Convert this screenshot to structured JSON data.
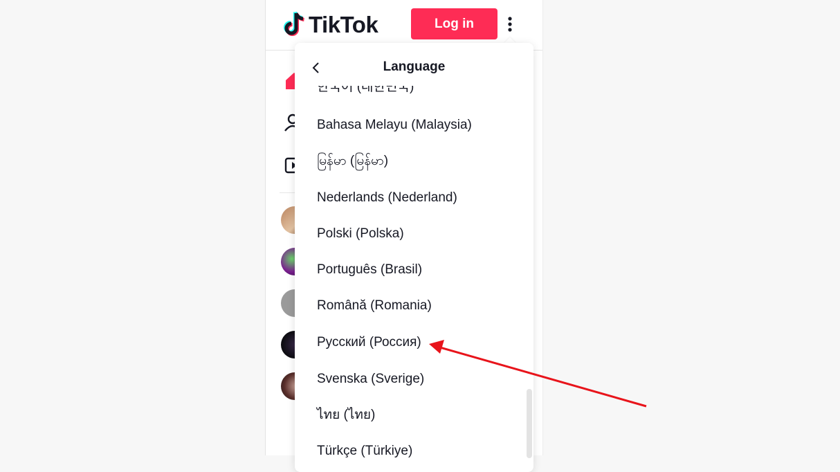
{
  "header": {
    "logo_text": "TikTok",
    "login_label": "Log in"
  },
  "language_menu": {
    "title": "Language",
    "items": [
      "한국어 (대한민국)",
      "Bahasa Melayu (Malaysia)",
      "မြန်မာ (မြန်မာ)",
      "Nederlands (Nederland)",
      "Polski (Polska)",
      "Português (Brasil)",
      "Română (Romania)",
      "Русский (Россия)",
      "Svenska (Sverige)",
      "ไทย (ไทย)",
      "Türkçe (Türkiye)"
    ]
  },
  "colors": {
    "brand_red": "#fe2c55",
    "annotation_arrow": "#e8141b"
  },
  "icons": {
    "logo": "tiktok-note-icon",
    "more": "vertical-dots-icon",
    "back": "chevron-left-icon",
    "home": "home-icon",
    "following": "user-icon",
    "live": "live-icon"
  }
}
